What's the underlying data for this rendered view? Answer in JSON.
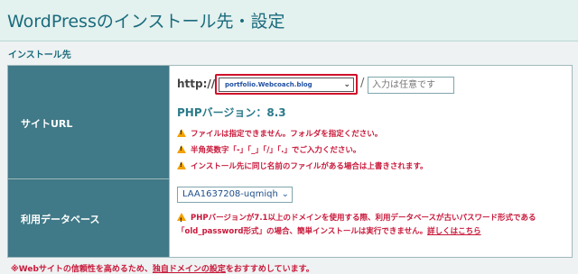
{
  "page": {
    "title": "WordPressのインストール先・設定",
    "section_label": "インストール先"
  },
  "site_url": {
    "label": "サイトURL",
    "http_prefix": "http://",
    "domain_selected": "portfolio.Webcoach.blog",
    "slash": "/",
    "directory_placeholder": "入力は任意です",
    "php_version": "PHPバージョン：8.3",
    "notes": [
      "ファイルは指定できません。フォルダを指定ください。",
      "半角英数字「-」「_」「/」「.」でご入力ください。",
      "インストール先に同じ名前のファイルがある場合は上書きされます。"
    ]
  },
  "database": {
    "label": "利用データベース",
    "selected": "LAA1637208-uqmiqh",
    "warning_text": "PHPバージョンが7.1以上のドメインを使用する際、利用データベースが古いパスワード形式である「old_password形式」の場合、簡単インストールは実行できません。",
    "warning_link": "詳しくはこちら"
  },
  "footer": {
    "text_before": "※Webサイトの信頼性を高めるため、",
    "link": "独自ドメインの設定",
    "text_after": "をおすすめしています。"
  },
  "colors": {
    "accent": "#407987",
    "title": "#1a6b7c",
    "warning": "#c9183a",
    "highlight": "#d0102a"
  }
}
